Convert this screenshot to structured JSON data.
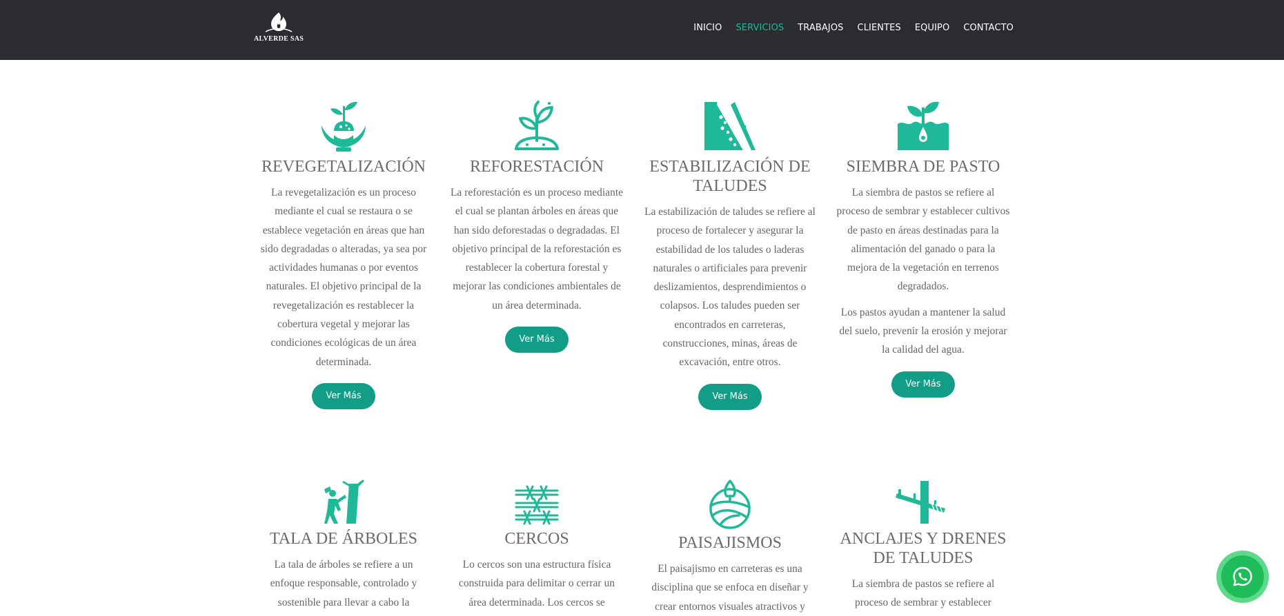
{
  "header": {
    "logo_text": "ALVERDE SAS",
    "nav": [
      {
        "label": "INICIO",
        "active": false
      },
      {
        "label": "SERVICIOS",
        "active": true
      },
      {
        "label": "TRABAJOS",
        "active": false
      },
      {
        "label": "CLIENTES",
        "active": false
      },
      {
        "label": "EQUIPO",
        "active": false
      },
      {
        "label": "CONTACTO",
        "active": false
      }
    ]
  },
  "colors": {
    "accent": "#1fb99a",
    "button": "#129e86",
    "header_bg": "#2b2c2f",
    "text": "#666666",
    "whatsapp": "#1fbd5a"
  },
  "services": [
    {
      "icon": "plant-in-hands-icon",
      "title": "REVEGETALIZACIÓN",
      "paragraphs": [
        "La revegetalización es un proceso mediante el cual se restaura o se establece vegetación en áreas que han sido degradadas o alteradas, ya sea por actividades humanas o por eventos naturales. El objetivo principal de la revegetalización es restablecer la cobertura vegetal y mejorar las condiciones ecológicas de un área determinada."
      ],
      "button": "Ver Más"
    },
    {
      "icon": "sprout-icon",
      "title": "REFORESTACIÓN",
      "paragraphs": [
        "La reforestación es un proceso mediante el cual se plantan árboles en áreas que han sido deforestadas o degradadas. El objetivo principal de la reforestación es restablecer la cobertura forestal y mejorar las condiciones ambientales de un área determinada."
      ],
      "button": "Ver Más"
    },
    {
      "icon": "slope-icon",
      "title": "ESTABILIZACIÓN DE TALUDES",
      "paragraphs": [
        "La estabilización de taludes se refiere al proceso de fortalecer y asegurar la estabilidad de los taludes o laderas naturales o artificiales para prevenir deslizamientos, desprendimientos o colapsos. Los taludes pueden ser encontrados en carreteras, construcciones, minas, áreas de excavación, entre otros."
      ],
      "button": "Ver Más"
    },
    {
      "icon": "seed-sprout-icon",
      "title": "SIEMBRA DE PASTO",
      "paragraphs": [
        "La siembra de pastos se refiere al proceso de sembrar y establecer cultivos de pasto en áreas destinadas para la alimentación del ganado o para la mejora de la vegetación en terrenos degradados.",
        "Los pastos ayudan a mantener la salud del suelo, prevenir la erosión y mejorar la calidad del agua."
      ],
      "button": "Ver Más"
    },
    {
      "icon": "tree-felling-icon",
      "title": "TALA DE ÁRBOLES",
      "paragraphs": [
        "La tala de árboles se refiere a un enfoque responsable, controlado y sostenible para llevar a cabo la"
      ]
    },
    {
      "icon": "barbed-wire-icon",
      "title": "CERCOS",
      "paragraphs": [
        "Lo cercos son una estructura física construida para delimitar o cerrar un área determinada. Los cercos se"
      ]
    },
    {
      "icon": "landscape-icon",
      "title": "PAISAJISMOS",
      "paragraphs": [
        "El paisajismo en carreteras es una disciplina que se enfoca en diseñar y crear entornos visuales atractivos y"
      ]
    },
    {
      "icon": "anchor-drain-icon",
      "title": "ANCLAJES Y DRENES DE TALUDES",
      "paragraphs": [
        "La siembra de pastos se refiere al proceso de sembrar y establecer"
      ]
    }
  ],
  "whatsapp": {
    "icon": "whatsapp-icon"
  }
}
